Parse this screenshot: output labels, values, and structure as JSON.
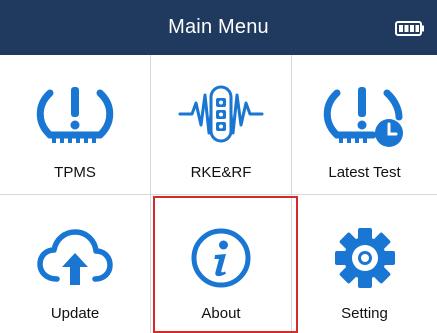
{
  "header": {
    "title": "Main Menu",
    "battery_icon": "battery-full-icon"
  },
  "menu": {
    "items": [
      {
        "label": "TPMS",
        "icon": "tire-warning-icon"
      },
      {
        "label": "RKE&RF",
        "icon": "key-fob-signal-icon"
      },
      {
        "label": "Latest Test",
        "icon": "tire-clock-icon"
      },
      {
        "label": "Update",
        "icon": "cloud-upload-icon"
      },
      {
        "label": "About",
        "icon": "info-icon"
      },
      {
        "label": "Setting",
        "icon": "gear-icon"
      }
    ],
    "selected_label": "About"
  },
  "colors": {
    "header_bg": "#1f3a5e",
    "icon_blue": "#1976d2",
    "selection_red": "#d42a2a",
    "divider": "#d8d8d8"
  }
}
